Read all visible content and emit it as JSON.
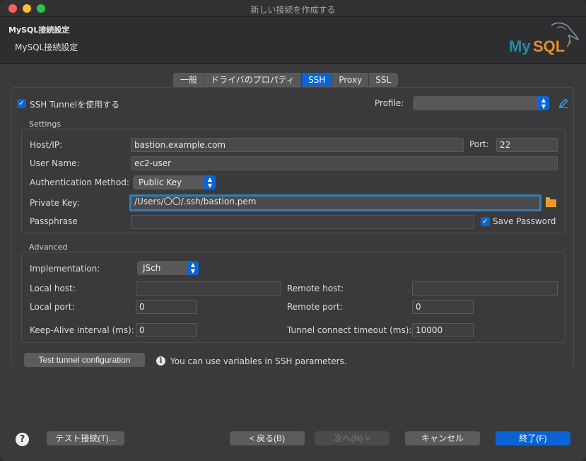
{
  "window": {
    "title": "新しい接続を作成する"
  },
  "header": {
    "title": "MySQL接続設定",
    "subtitle": "MySQL接続設定",
    "logo_text": "MySQL"
  },
  "tabs": [
    {
      "label": "一般",
      "active": false
    },
    {
      "label": "ドライバのプロパティ",
      "active": false
    },
    {
      "label": "SSH",
      "active": true
    },
    {
      "label": "Proxy",
      "active": false
    },
    {
      "label": "SSL",
      "active": false
    }
  ],
  "ssh": {
    "use_tunnel_label": "SSH Tunnelを使用する",
    "use_tunnel_checked": true,
    "profile_label": "Profile:",
    "profile_value": "",
    "settings_label": "Settings",
    "host_label": "Host/IP:",
    "host_value": "bastion.example.com",
    "port_label": "Port:",
    "port_value": "22",
    "user_label": "User Name:",
    "user_value": "ec2-user",
    "auth_label": "Authentication Method:",
    "auth_value": "Public Key",
    "key_label": "Private Key:",
    "key_value": "/Users/〇〇/.ssh/bastion.pem",
    "pass_label": "Passphrase",
    "pass_value": "",
    "save_pass_label": "Save Password",
    "save_pass_checked": true,
    "advanced_label": "Advanced",
    "impl_label": "Implementation:",
    "impl_value": "JSch",
    "local_host_label": "Local host:",
    "local_host_value": "",
    "remote_host_label": "Remote host:",
    "remote_host_value": "",
    "local_port_label": "Local port:",
    "local_port_value": "0",
    "remote_port_label": "Remote port:",
    "remote_port_value": "0",
    "keepalive_label": "Keep-Alive interval (ms):",
    "keepalive_value": "0",
    "timeout_label": "Tunnel connect timeout (ms):",
    "timeout_value": "10000",
    "test_button": "Test tunnel configuration",
    "info_text": "You can use variables in SSH parameters."
  },
  "footer": {
    "help": "?",
    "test_connection": "テスト接続(T)...",
    "back": "< 戻る(B)",
    "next": "次へ(N) >",
    "cancel": "キャンセル",
    "finish": "終了(F)"
  },
  "colors": {
    "accent": "#0a64d6",
    "focus_ring": "#2f7fb8",
    "folder": "#f09a2d",
    "mysql_teal": "#1e8da8",
    "mysql_orange": "#e48e2c"
  },
  "icons": {
    "help": "question-icon",
    "info": "info-icon",
    "folder": "folder-icon",
    "edit": "pencil-icon",
    "logo": "mysql-dolphin-icon"
  }
}
